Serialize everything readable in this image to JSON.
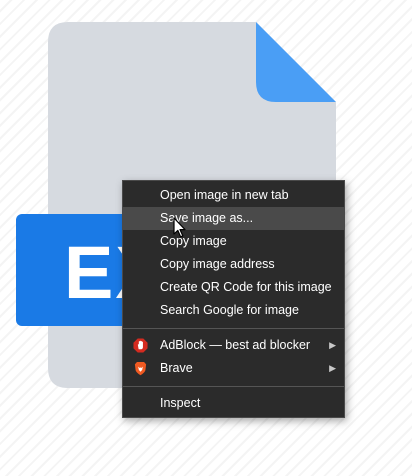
{
  "badge": {
    "text": "EX"
  },
  "context_menu": {
    "group1": [
      {
        "label": "Open image in new tab"
      },
      {
        "label": "Save image as..."
      },
      {
        "label": "Copy image"
      },
      {
        "label": "Copy image address"
      },
      {
        "label": "Create QR Code for this image"
      },
      {
        "label": "Search Google for image"
      }
    ],
    "extensions": [
      {
        "label": "AdBlock — best ad blocker",
        "icon": "adblock-icon",
        "submenu": true
      },
      {
        "label": "Brave",
        "icon": "brave-lion-icon",
        "submenu": true
      }
    ],
    "inspect": {
      "label": "Inspect"
    }
  },
  "colors": {
    "file_body": "#d6dae0",
    "file_corner": "#4a9ef5",
    "badge": "#1a7ae6",
    "menu_bg": "#2b2b2b",
    "hover_bg": "#4a4a4a"
  }
}
